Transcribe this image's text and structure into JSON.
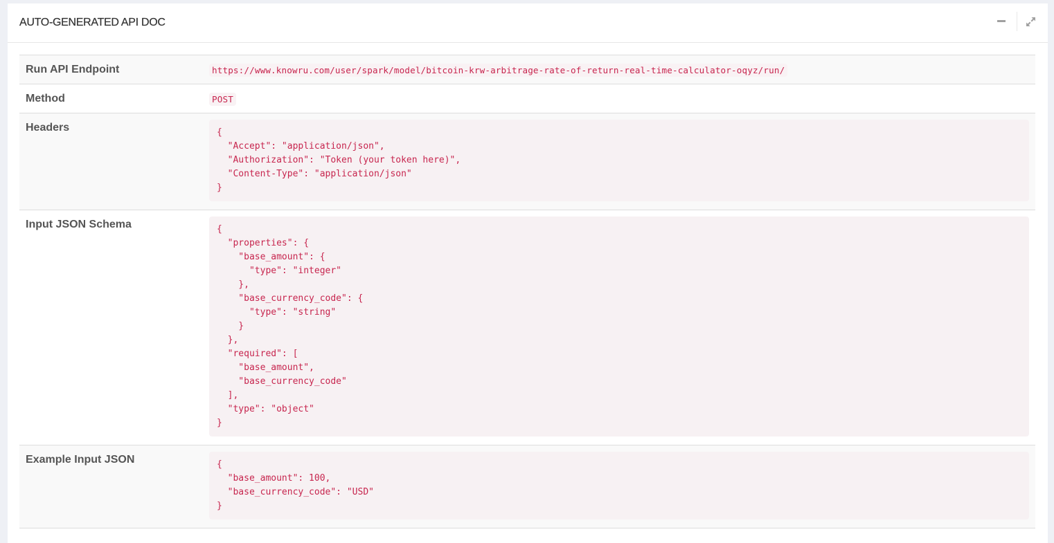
{
  "panel": {
    "title": "AUTO-GENERATED API DOC",
    "tools": {
      "minimize_icon": "minus-icon",
      "expand_icon": "expand-arrows-icon"
    }
  },
  "doc": {
    "rows": [
      {
        "label": "Run API Endpoint",
        "value": "https://www.knowru.com/user/spark/model/bitcoin-krw-arbitrage-rate-of-return-real-time-calculator-oqyz/run/"
      },
      {
        "label": "Method",
        "value": "POST"
      },
      {
        "label": "Headers",
        "value": "{\n  \"Accept\": \"application/json\",\n  \"Authorization\": \"Token (your token here)\",\n  \"Content-Type\": \"application/json\"\n}"
      },
      {
        "label": "Input JSON Schema",
        "value": "{\n  \"properties\": {\n    \"base_amount\": {\n      \"type\": \"integer\"\n    },\n    \"base_currency_code\": {\n      \"type\": \"string\"\n    }\n  },\n  \"required\": [\n    \"base_amount\",\n    \"base_currency_code\"\n  ],\n  \"type\": \"object\"\n}"
      },
      {
        "label": "Example Input JSON",
        "value": "{\n  \"base_amount\": 100,\n  \"base_currency_code\": \"USD\"\n}"
      }
    ]
  },
  "colors": {
    "code_text": "#c7254e",
    "code_bg": "#f7f1f3",
    "label_text": "#555555"
  }
}
